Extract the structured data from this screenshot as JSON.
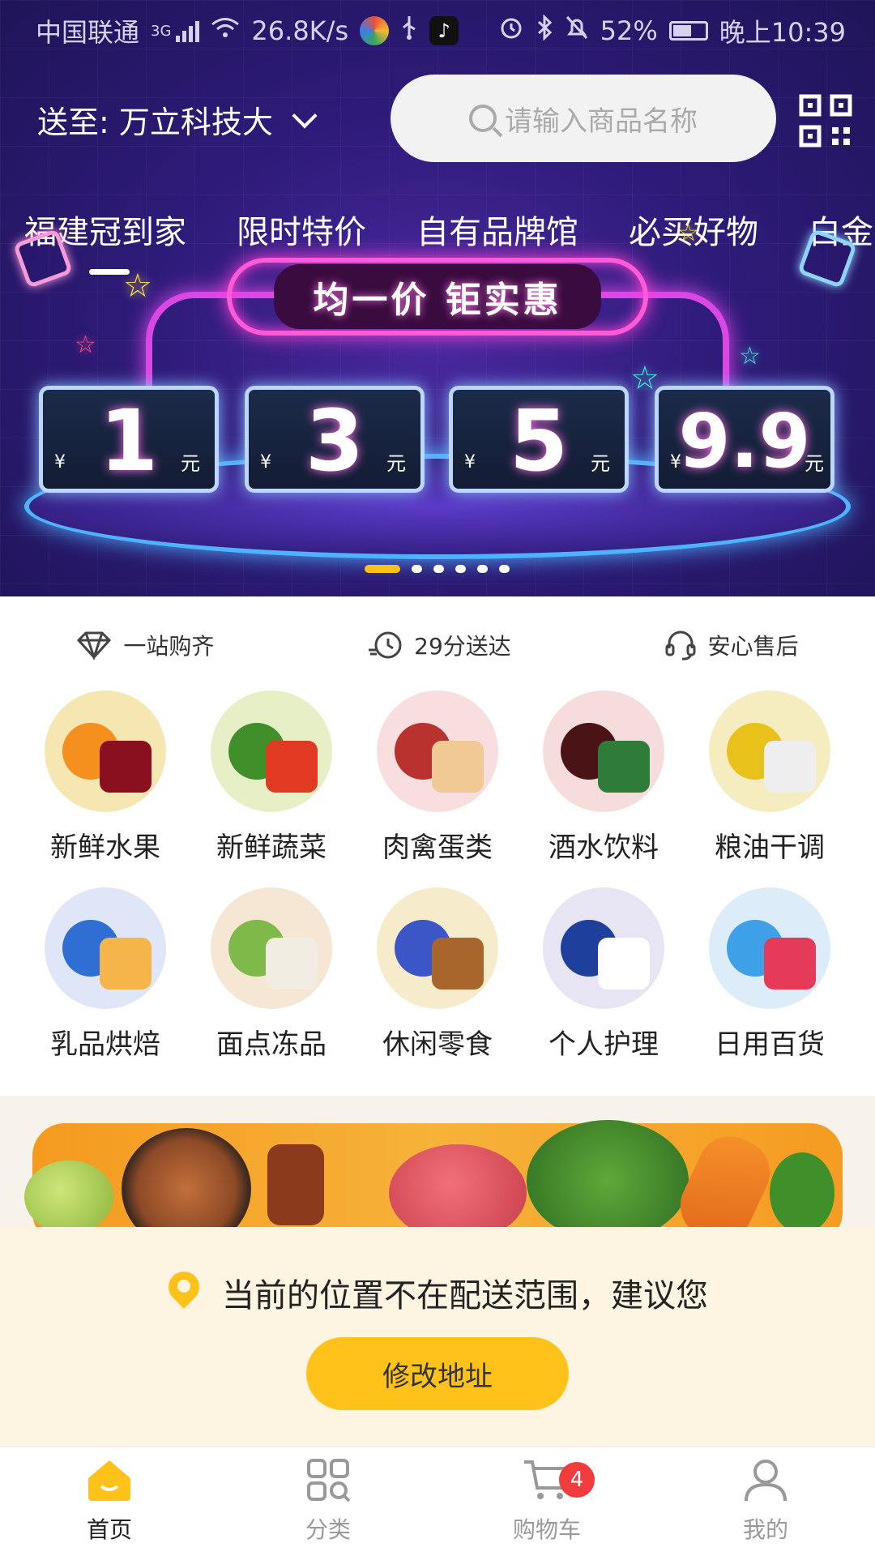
{
  "status_bar": {
    "carrier": "中国联通",
    "network": "3G",
    "speed": "26.8K/s",
    "battery": "52%",
    "time": "晚上10:39"
  },
  "header": {
    "delivery_to": "送至: 万立科技大",
    "search_placeholder": "请输入商品名称"
  },
  "tabs": [
    {
      "label": "福建冠到家"
    },
    {
      "label": "限时特价"
    },
    {
      "label": "自有品牌馆"
    },
    {
      "label": "必买好物"
    },
    {
      "label": "白金"
    }
  ],
  "banner": {
    "title": "均一价 钜实惠",
    "currency": "¥",
    "unit": "元",
    "prices": [
      "1",
      "3",
      "5",
      "9.9"
    ],
    "page_count": 6,
    "active_page": 0
  },
  "features": [
    {
      "icon": "diamond-icon",
      "label": "一站购齐"
    },
    {
      "icon": "delivery-clock-icon",
      "label": "29分送达"
    },
    {
      "icon": "headset-icon",
      "label": "安心售后"
    }
  ],
  "categories": [
    {
      "name": "新鲜水果",
      "bg": "#f6e7b2",
      "c1": "#f5901e",
      "c2": "#8a1020"
    },
    {
      "name": "新鲜蔬菜",
      "bg": "#e6efc5",
      "c1": "#3f8f2a",
      "c2": "#e03a22"
    },
    {
      "name": "肉禽蛋类",
      "bg": "#f8dede",
      "c1": "#b8322f",
      "c2": "#f0c995"
    },
    {
      "name": "酒水饮料",
      "bg": "#f6dcdc",
      "c1": "#4a1416",
      "c2": "#2f7b3a"
    },
    {
      "name": "粮油干调",
      "bg": "#f5ecc0",
      "c1": "#e8c21a",
      "c2": "#eeeeee"
    },
    {
      "name": "乳品烘焙",
      "bg": "#dfe6f7",
      "c1": "#2f6fd3",
      "c2": "#f4b64a"
    },
    {
      "name": "面点冻品",
      "bg": "#f6e7d4",
      "c1": "#7fb94a",
      "c2": "#f2ede3"
    },
    {
      "name": "休闲零食",
      "bg": "#f6eccb",
      "c1": "#3a56c7",
      "c2": "#a8652c"
    },
    {
      "name": "个人护理",
      "bg": "#e7e4f3",
      "c1": "#1e3f9c",
      "c2": "#ffffff"
    },
    {
      "name": "日用百货",
      "bg": "#dcecf8",
      "c1": "#3ea0e6",
      "c2": "#e53a58"
    }
  ],
  "notice": {
    "message": "当前的位置不在配送范围，建议您",
    "button": "修改地址"
  },
  "bottom_nav": [
    {
      "label": "首页",
      "active": true
    },
    {
      "label": "分类",
      "active": false
    },
    {
      "label": "购物车",
      "active": false,
      "badge": "4"
    },
    {
      "label": "我的",
      "active": false
    }
  ],
  "colors": {
    "accent": "#ffc21a",
    "hero_bg": "#2f1b7a",
    "badge": "#f03c3c"
  }
}
